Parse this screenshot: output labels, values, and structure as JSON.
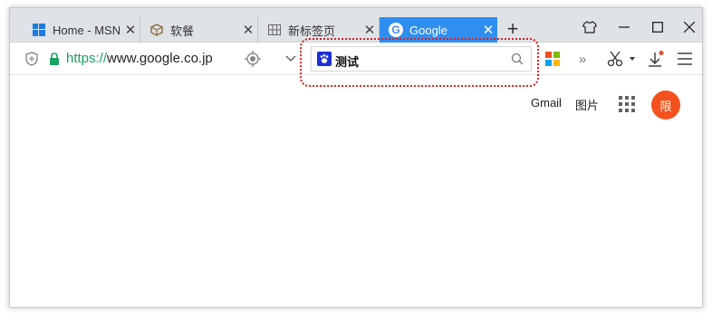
{
  "tabs": [
    {
      "title": "Home - MSN",
      "icon": "windows-logo-icon",
      "active": false
    },
    {
      "title": "软餐",
      "icon": "package-icon",
      "active": false
    },
    {
      "title": "新标签页",
      "icon": "grid-icon",
      "active": false
    },
    {
      "title": "Google",
      "icon": "google-g-icon",
      "active": true
    }
  ],
  "address": {
    "protocol": "https://",
    "host": "www.google.co.jp"
  },
  "search": {
    "query": "测试",
    "engine_icon": "baidu-paw-icon"
  },
  "google_bar": {
    "gmail": "Gmail",
    "images": "图片",
    "avatar_letter": "限"
  },
  "colors": {
    "active_tab": "#2f8ef0",
    "highlight_border": "#e02020",
    "avatar_bg": "#f4511e",
    "protocol_green": "#1aa260"
  }
}
